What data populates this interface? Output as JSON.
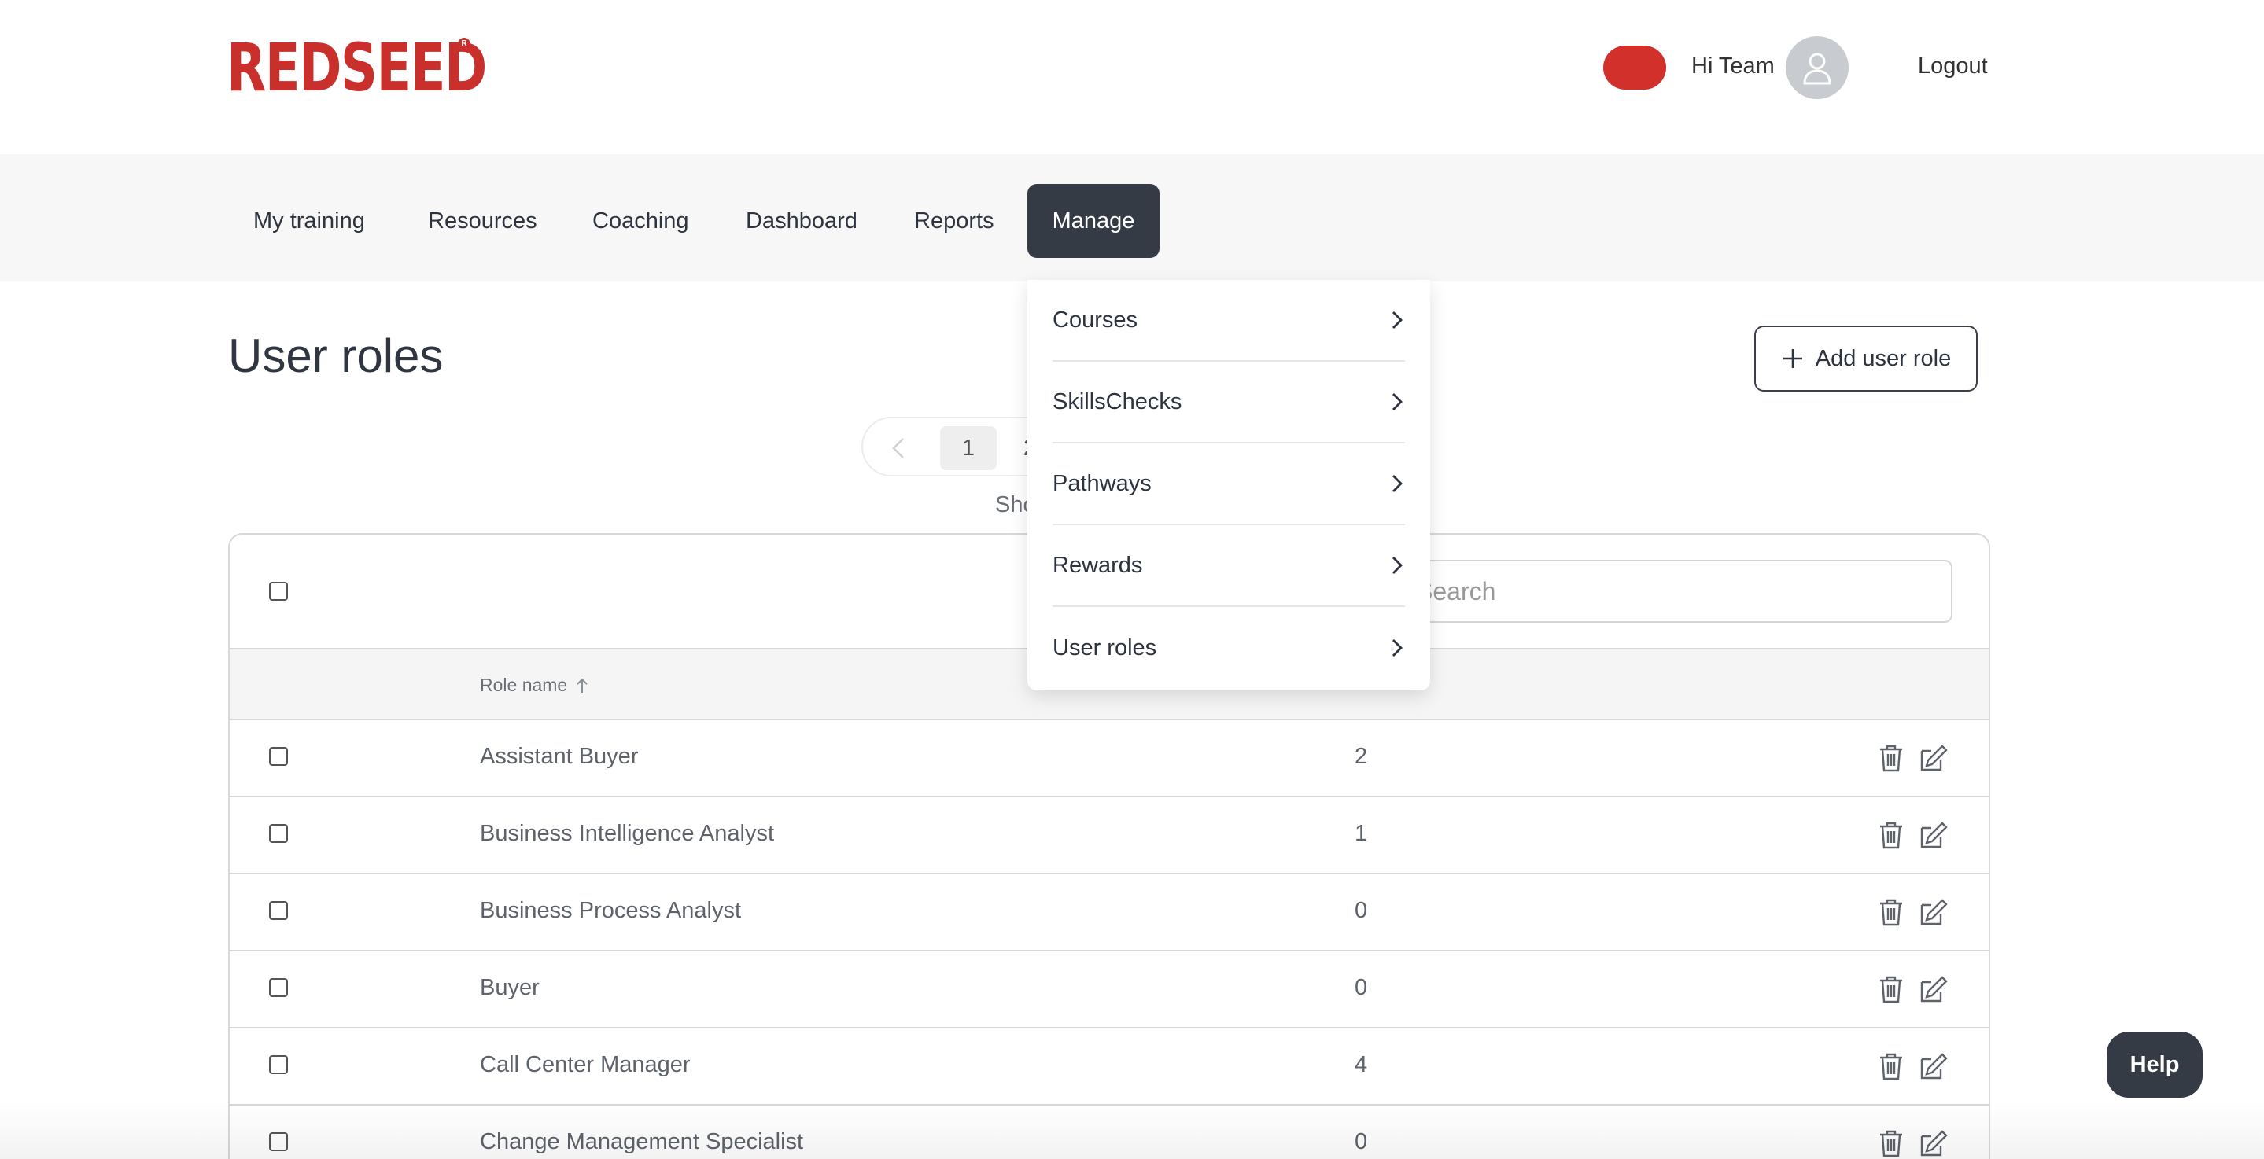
{
  "header": {
    "logo": "REDSEED",
    "logo_mark": "R",
    "greeting": "Hi Team",
    "logout": "Logout",
    "toggle_color": "#d1302b"
  },
  "nav": {
    "items": [
      {
        "label": "My training"
      },
      {
        "label": "Resources"
      },
      {
        "label": "Coaching"
      },
      {
        "label": "Dashboard"
      },
      {
        "label": "Reports"
      },
      {
        "label": "Manage",
        "active": true
      }
    ]
  },
  "dropdown": {
    "items": [
      {
        "label": "Courses"
      },
      {
        "label": "SkillsChecks"
      },
      {
        "label": "Pathways"
      },
      {
        "label": "Rewards"
      },
      {
        "label": "User roles"
      }
    ]
  },
  "page": {
    "title": "User roles",
    "add_button": "Add user role",
    "pager": {
      "pages": [
        "1",
        "2"
      ],
      "current": "1"
    },
    "showing": "Sho"
  },
  "table": {
    "search_placeholder": "Search",
    "columns": {
      "role_name": "Role name"
    },
    "rows": [
      {
        "name": "Assistant Buyer",
        "count": "2"
      },
      {
        "name": "Business Intelligence Analyst",
        "count": "1"
      },
      {
        "name": "Business Process Analyst",
        "count": "0"
      },
      {
        "name": "Buyer",
        "count": "0"
      },
      {
        "name": "Call Center Manager",
        "count": "4"
      },
      {
        "name": "Change Management Specialist",
        "count": "0"
      }
    ]
  },
  "help": {
    "label": "Help"
  },
  "colors": {
    "brand": "#c9302c",
    "dark": "#343b44"
  }
}
